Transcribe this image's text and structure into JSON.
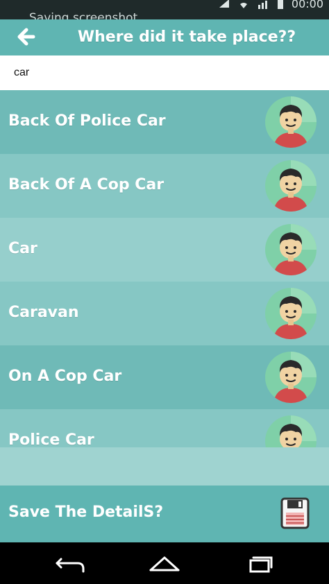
{
  "status_bar": {
    "notification_text": "Saving screenshot...",
    "time": "00:00",
    "icons": [
      "signal-icon",
      "wifi-icon",
      "data-icon",
      "battery-icon"
    ]
  },
  "header": {
    "title": "Where did it take place??",
    "back_icon": "arrow-left-icon"
  },
  "search": {
    "value": "car",
    "placeholder": ""
  },
  "list": {
    "items": [
      {
        "label": "Back Of Police Car",
        "avatar": "man-avatar-icon"
      },
      {
        "label": "Back Of A Cop Car",
        "avatar": "man-avatar-icon"
      },
      {
        "label": "Car",
        "avatar": "man-avatar-icon"
      },
      {
        "label": "Caravan",
        "avatar": "man-avatar-icon"
      },
      {
        "label": "On A Cop Car",
        "avatar": "man-avatar-icon"
      },
      {
        "label": "Police Car",
        "avatar": "man-avatar-icon"
      }
    ]
  },
  "footer": {
    "save_label": "Save The DetailS?",
    "save_icon": "floppy-disk-icon"
  },
  "navbar": {
    "back_icon": "nav-back-icon",
    "home_icon": "nav-home-icon",
    "recents_icon": "nav-recents-icon"
  },
  "colors": {
    "header": "#5fb5b2",
    "list_row_dark": "#6fbab7",
    "list_row_mid": "#86c7c4",
    "list_row_light": "#96cfcc",
    "footer": "#5fb5b2"
  }
}
